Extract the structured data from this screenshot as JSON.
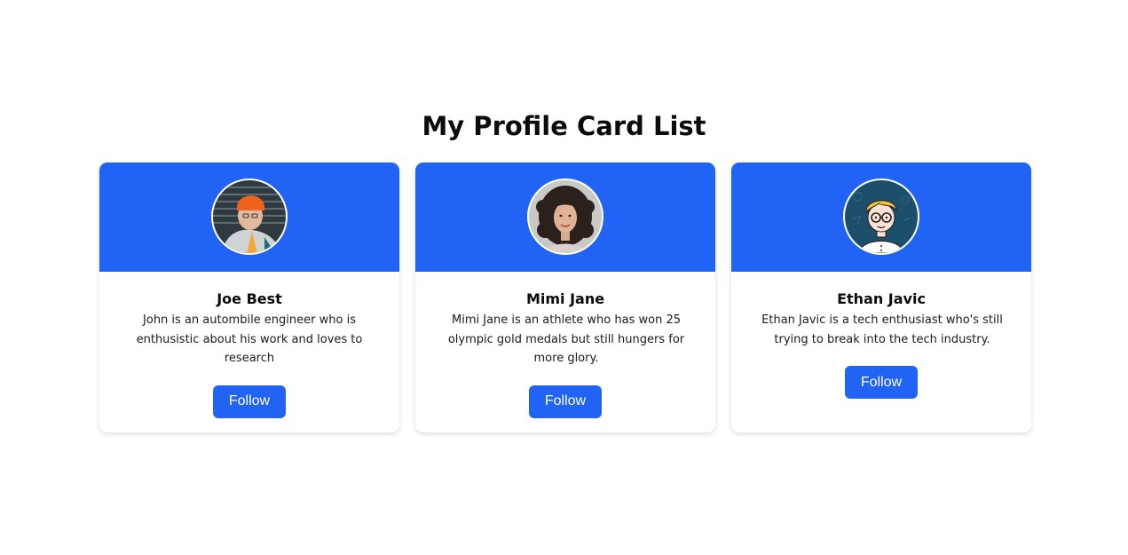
{
  "page": {
    "title": "My Profile Card List"
  },
  "colors": {
    "accent": "#2163f5",
    "card_background": "#ffffff"
  },
  "cards": [
    {
      "name": "Joe Best",
      "bio": "John is an autombile engineer who is enthusistic about his work and loves to research",
      "follow_label": "Follow",
      "avatar_icon": "man-orange-beanie-photo"
    },
    {
      "name": "Mimi Jane",
      "bio": "Mimi Jane is an athlete who has won 25 olympic gold medals but still hungers for more glory.",
      "follow_label": "Follow",
      "avatar_icon": "woman-curly-hair-photo"
    },
    {
      "name": "Ethan Javic",
      "bio": "Ethan Javic is a tech enthusiast who's still trying to break into the tech industry.",
      "follow_label": "Follow",
      "avatar_icon": "cartoon-boy-glasses-illustration"
    }
  ]
}
